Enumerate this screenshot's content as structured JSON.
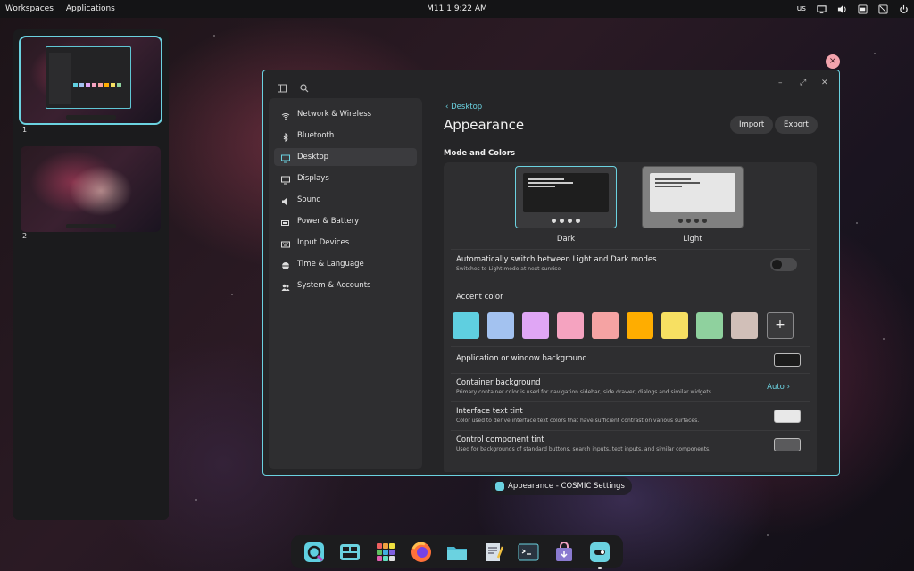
{
  "top_panel": {
    "workspaces_label": "Workspaces",
    "applications_label": "Applications",
    "clock": "M11 1 9:22 AM",
    "keyboard_layout": "us",
    "tray_icons": [
      "display-icon",
      "volume-icon",
      "network-icon",
      "notifications-off-icon",
      "power-icon"
    ]
  },
  "workspaces": [
    {
      "label": "1",
      "active": true
    },
    {
      "label": "2",
      "active": false
    }
  ],
  "window": {
    "close_badge": "×",
    "headerbar": {
      "sidebar_toggle_icon": "sidebar-icon",
      "search_icon": "search-icon",
      "minimize": "–",
      "maximize": "⤢",
      "close": "✕"
    },
    "sidebar": {
      "items": [
        {
          "label": "Network & Wireless",
          "icon": "wifi-icon"
        },
        {
          "label": "Bluetooth",
          "icon": "bluetooth-icon"
        },
        {
          "label": "Desktop",
          "icon": "desktop-icon",
          "active": true
        },
        {
          "label": "Displays",
          "icon": "display-icon"
        },
        {
          "label": "Sound",
          "icon": "speaker-icon"
        },
        {
          "label": "Power & Battery",
          "icon": "battery-icon"
        },
        {
          "label": "Input Devices",
          "icon": "keyboard-icon"
        },
        {
          "label": "Time & Language",
          "icon": "globe-icon"
        },
        {
          "label": "System & Accounts",
          "icon": "users-icon"
        }
      ]
    },
    "content": {
      "back_label": "Desktop",
      "title": "Appearance",
      "import_label": "Import",
      "export_label": "Export",
      "section_title": "Mode and Colors",
      "modes": [
        {
          "label": "Dark",
          "selected": true
        },
        {
          "label": "Light",
          "selected": false
        }
      ],
      "auto_switch": {
        "title": "Automatically switch between Light and Dark modes",
        "subtitle": "Switches to Light mode at next sunrise",
        "enabled": false
      },
      "accent": {
        "title": "Accent color",
        "colors": [
          "#5fcfe0",
          "#a3c2f0",
          "#e0a6f5",
          "#f5a3c0",
          "#f5a3a3",
          "#ffad00",
          "#f7e062",
          "#8fd19e",
          "#d1bfb8"
        ],
        "add_label": "+"
      },
      "app_background": {
        "title": "Application or window background",
        "color": "#1b1b1b"
      },
      "container_background": {
        "title": "Container background",
        "subtitle": "Primary container color is used for navigation sidebar, side drawer, dialogs and similar widgets.",
        "value": "Auto"
      },
      "text_tint": {
        "title": "Interface text tint",
        "subtitle": "Color used to derive interface text colors that have sufficient contrast on various surfaces.",
        "color": "#e8e8e8"
      },
      "control_tint": {
        "title": "Control component tint",
        "subtitle": "Used for backgrounds of standard buttons, search inputs, text inputs, and similar components.",
        "color": "#5a5a5c"
      }
    }
  },
  "window_title_pill": "Appearance - COSMIC Settings",
  "dock": {
    "apps": [
      {
        "name": "launcher-icon",
        "color": "#5fcfe0"
      },
      {
        "name": "workspaces-icon",
        "color": "#6bd2e0"
      },
      {
        "name": "app-library-icon",
        "color": "#f0a040"
      },
      {
        "name": "firefox-icon",
        "color": "#ff7139"
      },
      {
        "name": "files-icon",
        "color": "#4ab8d0"
      },
      {
        "name": "text-editor-icon",
        "color": "#9ab0c0"
      },
      {
        "name": "terminal-icon",
        "color": "#2a3440"
      },
      {
        "name": "store-icon",
        "color": "#8a7ad0"
      },
      {
        "name": "settings-icon",
        "color": "#6bd2e0"
      }
    ]
  }
}
